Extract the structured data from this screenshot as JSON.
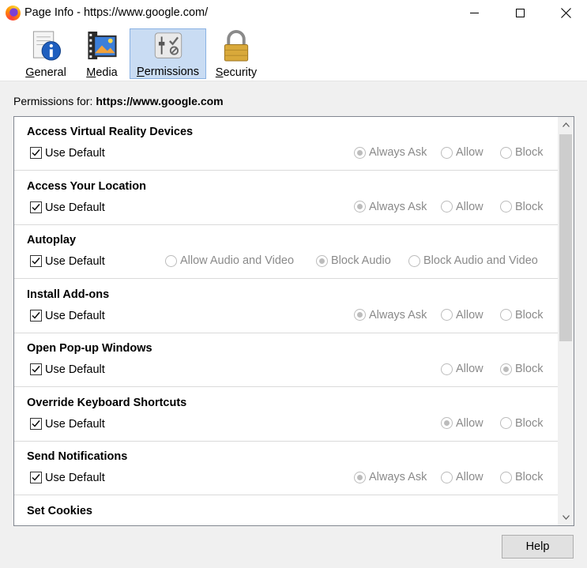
{
  "window": {
    "title": "Page Info - https://www.google.com/"
  },
  "toolbar": {
    "tabs": [
      {
        "key": "general",
        "first": "G",
        "rest": "eneral",
        "icon": "info-icon"
      },
      {
        "key": "media",
        "first": "M",
        "rest": "edia",
        "icon": "media-icon"
      },
      {
        "key": "permissions",
        "first": "P",
        "rest": "ermissions",
        "icon": "permissions-icon",
        "selected": true
      },
      {
        "key": "security",
        "first": "S",
        "rest": "ecurity",
        "icon": "padlock-icon"
      }
    ]
  },
  "permissions": {
    "label": "Permissions for:",
    "host": "https://www.google.com",
    "use_default_label": "Use Default",
    "items": [
      {
        "title": "Access Virtual Reality Devices",
        "use_default": true,
        "options": [
          {
            "label": "Always Ask",
            "selected": true
          },
          {
            "label": "Allow",
            "selected": false
          },
          {
            "label": "Block",
            "selected": false
          }
        ]
      },
      {
        "title": "Access Your Location",
        "use_default": true,
        "options": [
          {
            "label": "Always Ask",
            "selected": true
          },
          {
            "label": "Allow",
            "selected": false
          },
          {
            "label": "Block",
            "selected": false
          }
        ]
      },
      {
        "title": "Autoplay",
        "use_default": true,
        "options": [
          {
            "label": "Allow Audio and Video",
            "selected": false
          },
          {
            "label": "Block Audio",
            "selected": true
          },
          {
            "label": "Block Audio and Video",
            "selected": false
          }
        ]
      },
      {
        "title": "Install Add-ons",
        "use_default": true,
        "options": [
          {
            "label": "Always Ask",
            "selected": true
          },
          {
            "label": "Allow",
            "selected": false
          },
          {
            "label": "Block",
            "selected": false
          }
        ]
      },
      {
        "title": "Open Pop-up Windows",
        "use_default": true,
        "options": [
          {
            "label": "Allow",
            "selected": false
          },
          {
            "label": "Block",
            "selected": true
          }
        ]
      },
      {
        "title": "Override Keyboard Shortcuts",
        "use_default": true,
        "options": [
          {
            "label": "Allow",
            "selected": true
          },
          {
            "label": "Block",
            "selected": false
          }
        ]
      },
      {
        "title": "Send Notifications",
        "use_default": true,
        "options": [
          {
            "label": "Always Ask",
            "selected": true
          },
          {
            "label": "Allow",
            "selected": false
          },
          {
            "label": "Block",
            "selected": false
          }
        ]
      },
      {
        "title": "Set Cookies",
        "use_default": true,
        "options": []
      }
    ]
  },
  "footer": {
    "help_label": "Help"
  }
}
